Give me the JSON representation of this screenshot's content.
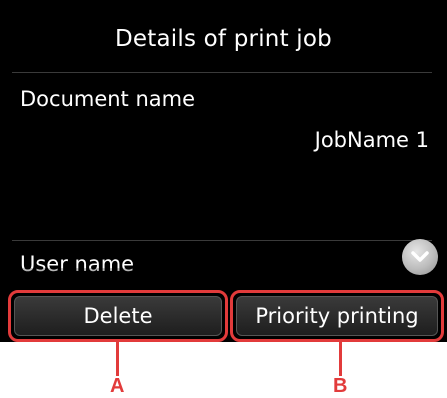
{
  "header": {
    "title": "Details of print job"
  },
  "details": {
    "document_name_label": "Document name",
    "document_name_value": "JobName 1",
    "user_name_label": "User name"
  },
  "scroll": {
    "icon": "chevron-down-icon"
  },
  "buttons": {
    "delete_label": "Delete",
    "priority_label": "Priority printing"
  },
  "callouts": {
    "a_label": "A",
    "b_label": "B"
  },
  "colors": {
    "screen_background": "#000000",
    "text": "#ffffff",
    "callout_red": "#e23b3b"
  }
}
